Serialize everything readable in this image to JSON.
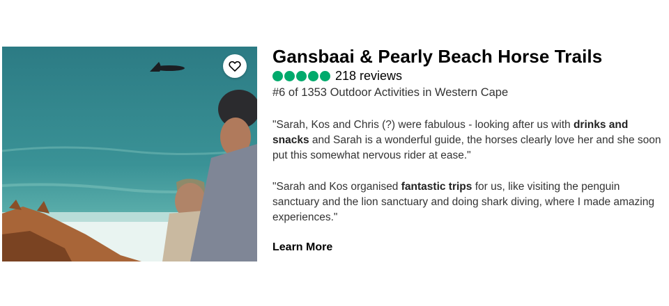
{
  "listing": {
    "title": "Gansbaai & Pearly Beach Horse Trails",
    "rating_bubbles": 5,
    "bubble_color": "#00aa6c",
    "reviews_label": "218 reviews",
    "ranking": "#6 of 1353 Outdoor Activities in Western Cape",
    "favorite_icon": "heart-outline-icon",
    "quotes": [
      {
        "parts": [
          "\"Sarah, Kos and Chris (?) were fabulous - looking after us with ",
          "drinks and snacks",
          " and Sarah is a wonderful guide, the horses clearly love her and she soon put this somewhat nervous rider at ease.\""
        ]
      },
      {
        "parts": [
          "\"Sarah and Kos organised ",
          "fantastic trips",
          " for us, like visiting the penguin sanctuary and the lion sanctuary and doing shark diving, where I made amazing experiences.\""
        ]
      }
    ],
    "learn_more_label": "Learn More"
  }
}
